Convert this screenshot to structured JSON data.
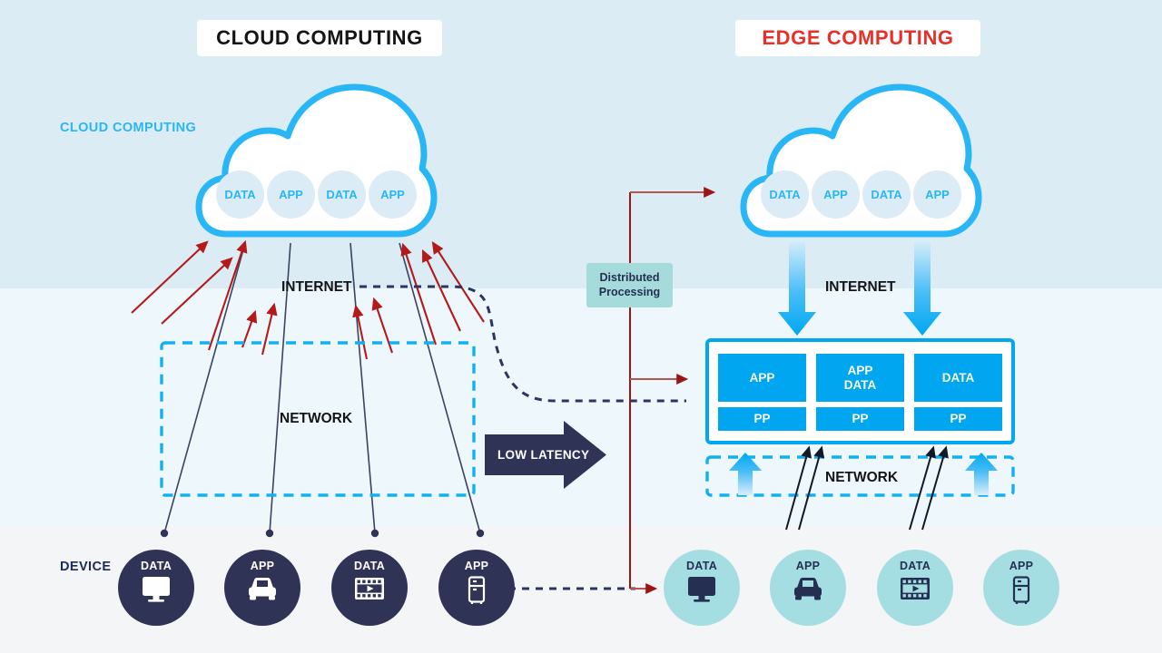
{
  "titles": {
    "left": "CLOUD COMPUTING",
    "right": "EDGE COMPUTING"
  },
  "labels": {
    "cloud_computing_side": "CLOUD COMPUTING",
    "device_side": "DEVICE",
    "internet_left": "INTERNET",
    "network_left": "NETWORK",
    "internet_right": "INTERNET",
    "network_right": "NETWORK",
    "low_latency": "LOW LATENCY",
    "distributed_processing_line1": "Distributed",
    "distributed_processing_line2": "Processing"
  },
  "cloud_left": {
    "pills": [
      "DATA",
      "APP",
      "DATA",
      "APP"
    ]
  },
  "cloud_right": {
    "pills": [
      "DATA",
      "APP",
      "DATA",
      "APP"
    ]
  },
  "edge_server": {
    "cells": [
      {
        "top_line1": "APP",
        "top_line2": "",
        "bottom": "PP"
      },
      {
        "top_line1": "APP",
        "top_line2": "DATA",
        "bottom": "PP"
      },
      {
        "top_line1": "DATA",
        "top_line2": "",
        "bottom": "PP"
      }
    ]
  },
  "devices_left": [
    {
      "label": "DATA",
      "icon": "monitor-icon"
    },
    {
      "label": "APP",
      "icon": "car-icon"
    },
    {
      "label": "DATA",
      "icon": "film-icon"
    },
    {
      "label": "APP",
      "icon": "refrigerator-icon"
    }
  ],
  "devices_right": [
    {
      "label": "DATA",
      "icon": "monitor-icon"
    },
    {
      "label": "APP",
      "icon": "car-icon"
    },
    {
      "label": "DATA",
      "icon": "film-icon"
    },
    {
      "label": "APP",
      "icon": "refrigerator-icon"
    }
  ],
  "colors": {
    "band_top": "#dcecf5",
    "band_mid": "#eef7fc",
    "band_bottom": "#f4f5f6",
    "cloud_outline": "#29b6f6",
    "accent_blue": "#00a7f0",
    "edge_red": "#e8302a",
    "arrow_red": "#b51a1a",
    "navy": "#2f3457",
    "teal": "#a5dee2",
    "dist_box": "#a5dbdb"
  }
}
